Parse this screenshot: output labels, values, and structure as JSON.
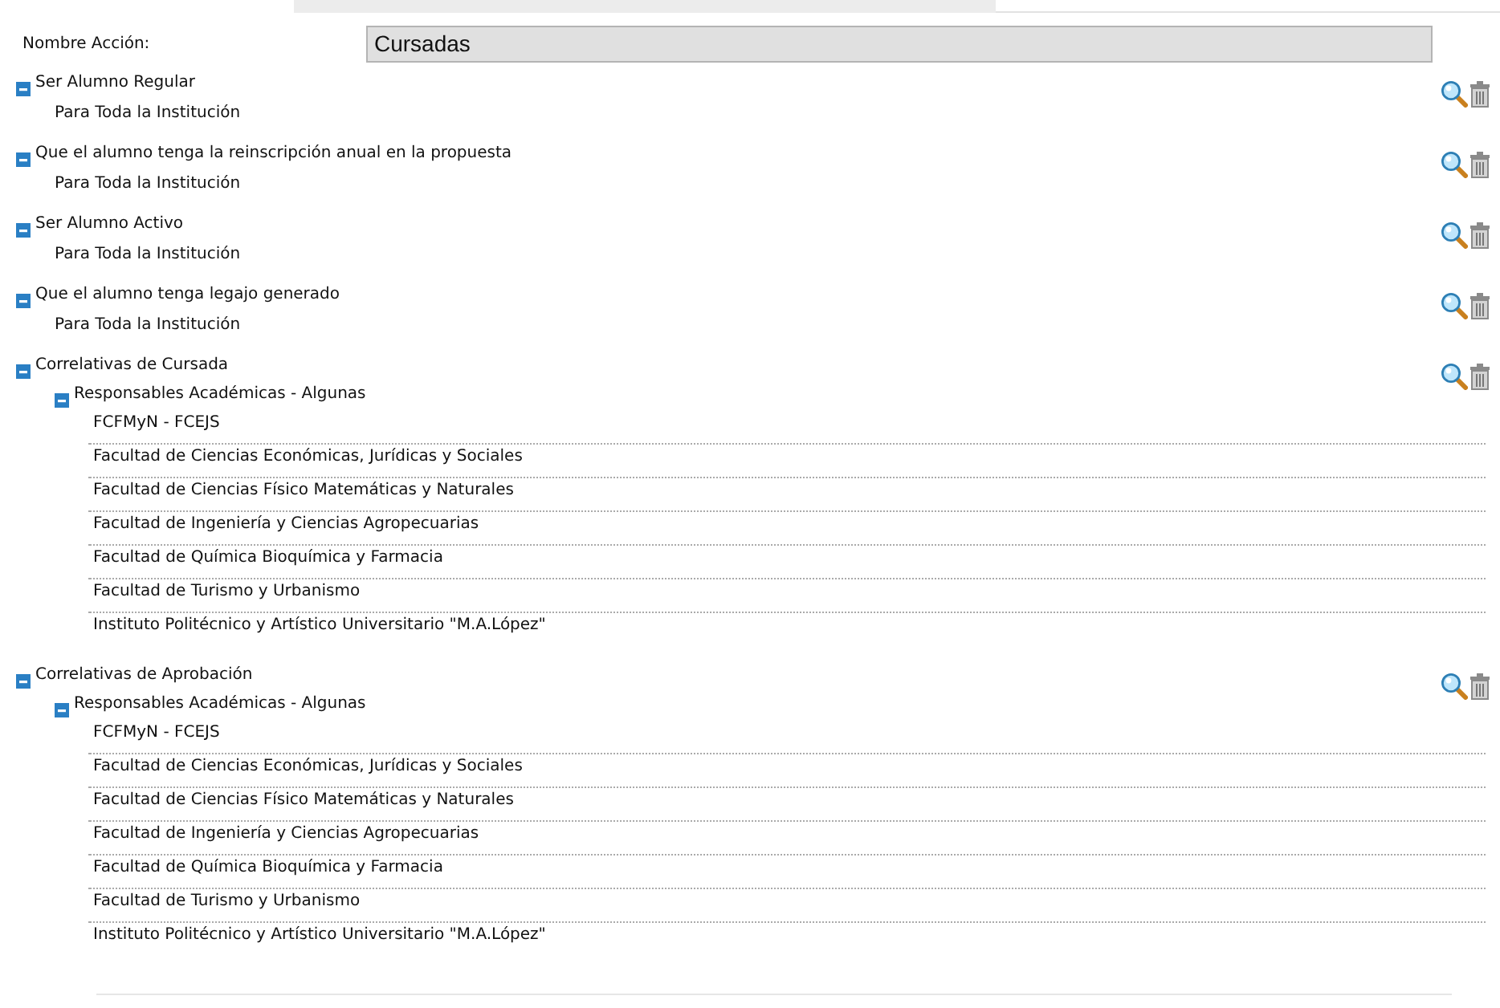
{
  "action_name": {
    "label": "Nombre Acción:",
    "value": "Cursadas"
  },
  "rules": [
    {
      "title": "Ser Alumno Regular",
      "expanded": true,
      "children": [
        {
          "label": "Para Toda la Institución"
        }
      ]
    },
    {
      "title": "Que el alumno tenga la reinscripción anual en la propuesta",
      "expanded": true,
      "children": [
        {
          "label": "Para Toda la Institución"
        }
      ]
    },
    {
      "title": "Ser Alumno Activo",
      "expanded": true,
      "children": [
        {
          "label": "Para Toda la Institución"
        }
      ]
    },
    {
      "title": "Que el alumno tenga legajo generado",
      "expanded": true,
      "children": [
        {
          "label": "Para Toda la Institución"
        }
      ]
    },
    {
      "title": "Correlativas de Cursada",
      "expanded": true,
      "children": [
        {
          "label": "Responsables Académicas - Algunas",
          "expanded": true,
          "items": [
            "FCFMyN - FCEJS",
            "Facultad de Ciencias Económicas, Jurídicas y Sociales",
            "Facultad de Ciencias Físico Matemáticas y Naturales",
            "Facultad de Ingeniería y Ciencias Agropecuarias",
            "Facultad de Química Bioquímica y Farmacia",
            "Facultad de Turismo y Urbanismo",
            "Instituto Politécnico y Artístico Universitario \"M.A.López\""
          ]
        }
      ]
    },
    {
      "title": "Correlativas de Aprobación",
      "expanded": true,
      "children": [
        {
          "label": "Responsables Académicas - Algunas",
          "expanded": true,
          "items": [
            "FCFMyN - FCEJS",
            "Facultad de Ciencias Económicas, Jurídicas y Sociales",
            "Facultad de Ciencias Físico Matemáticas y Naturales",
            "Facultad de Ingeniería y Ciencias Agropecuarias",
            "Facultad de Química Bioquímica y Farmacia",
            "Facultad de Turismo y Urbanismo",
            "Instituto Politécnico y Artístico Universitario \"M.A.López\""
          ]
        }
      ]
    }
  ]
}
